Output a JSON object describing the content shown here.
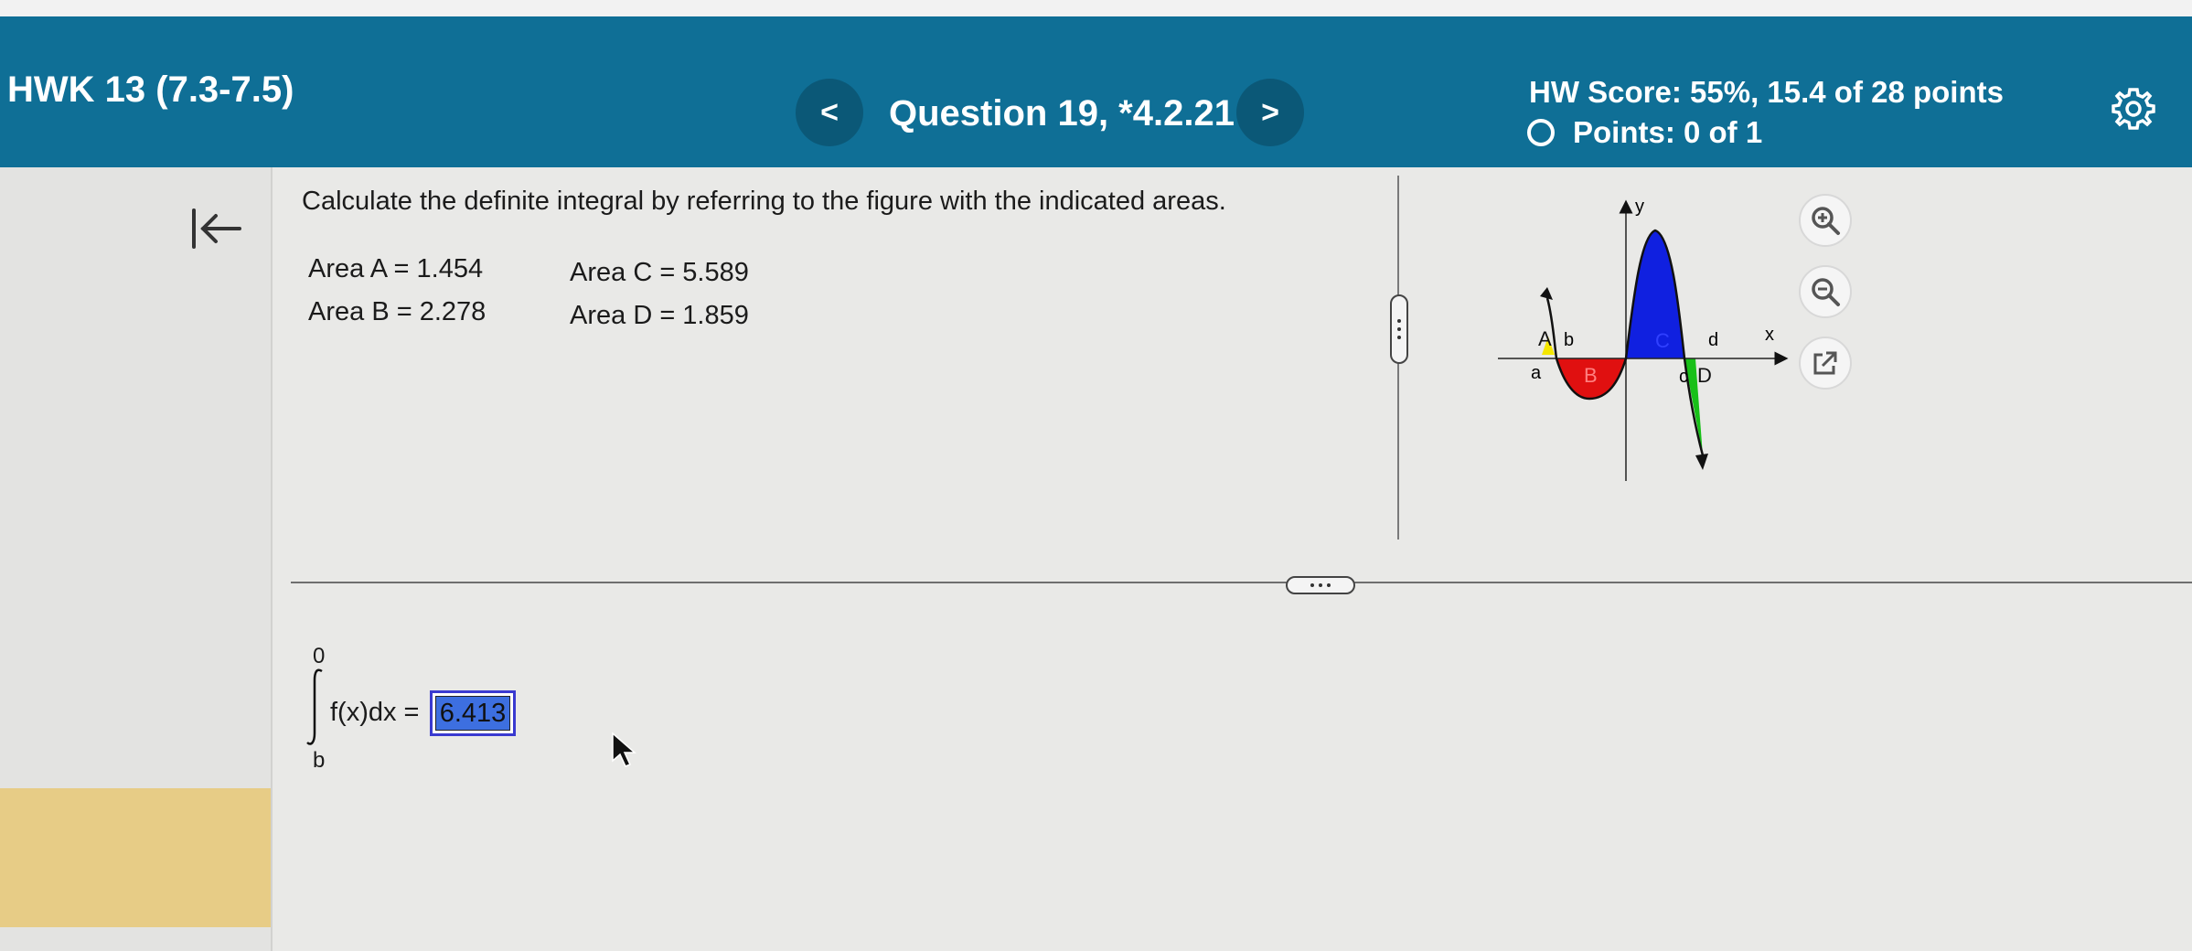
{
  "header": {
    "assignment_title": "HWK 13 (7.3-7.5)",
    "prev_label": "<",
    "question_title": "Question 19, *4.2.21",
    "next_label": ">",
    "hw_score": "HW Score: 55%, 15.4 of 28 points",
    "points": "Points: 0 of 1",
    "accent_color": "#0f6f96"
  },
  "sidebar": {
    "collapse_icon": "collapse-left-icon"
  },
  "question": {
    "prompt": "Calculate the definite integral by referring to the figure with the indicated areas.",
    "areas": {
      "a": "Area A = 1.454",
      "b": "Area B = 2.278",
      "c": "Area C = 5.589",
      "d": "Area D = 1.859"
    }
  },
  "graph": {
    "y_label": "y",
    "x_label": "x",
    "region_labels": [
      "A",
      "B",
      "C",
      "D"
    ],
    "point_labels": [
      "a",
      "b",
      "c",
      "d"
    ],
    "region_colors": {
      "A": "#f5e600",
      "B": "#e01010",
      "C": "#1020e0",
      "D": "#18c018"
    },
    "tools": [
      "zoom-in-icon",
      "zoom-out-icon",
      "external-link-icon"
    ]
  },
  "answer": {
    "upper_limit": "0",
    "lower_limit": "b",
    "integrand": "f(x)dx =",
    "value": "6.413"
  }
}
